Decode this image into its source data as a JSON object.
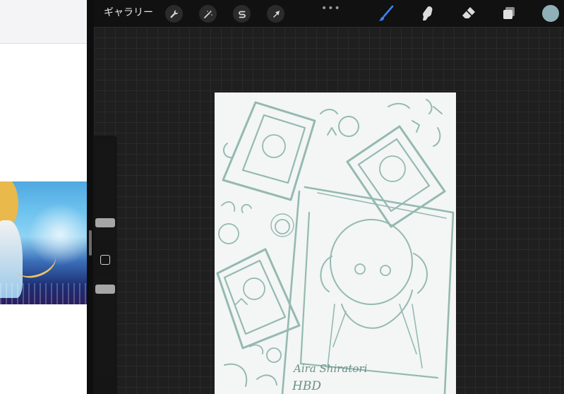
{
  "app": "Procreate",
  "toolbar": {
    "gallery_label": "ギャラリー",
    "more_label": "•••",
    "left_tools": [
      {
        "name": "actions",
        "icon": "wrench-icon"
      },
      {
        "name": "adjustments",
        "icon": "magic-wand-icon"
      },
      {
        "name": "selection",
        "icon": "selection-s-icon"
      },
      {
        "name": "transform",
        "icon": "arrow-cursor-icon"
      }
    ],
    "right_tools": [
      {
        "name": "brush",
        "icon": "brush-icon",
        "active": true
      },
      {
        "name": "smudge",
        "icon": "smudge-finger-icon"
      },
      {
        "name": "eraser",
        "icon": "eraser-icon"
      },
      {
        "name": "layers",
        "icon": "layers-icon"
      }
    ],
    "current_color": "#8fb0b6",
    "active_tool_color": "#3b82f6"
  },
  "artwork": {
    "signature_line1": "Aira Shiratori",
    "signature_line2": "HBD"
  },
  "colors": {
    "sketch_stroke": "#8bb3aa",
    "canvas_paper": "#f3f6f5",
    "toolbar_bg": "#111111"
  }
}
